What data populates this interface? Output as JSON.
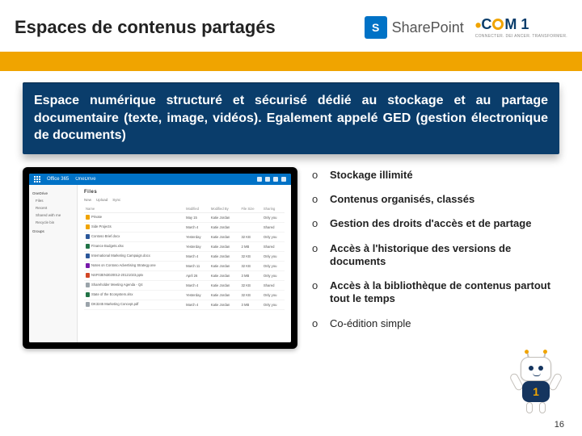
{
  "header": {
    "title": "Espaces de contenus partagés",
    "sharepoint": {
      "icon_letter": "S",
      "label": "SharePoint"
    },
    "com1": {
      "brand_c": "C",
      "brand_m1": "M 1",
      "tagline": "CONNECTER. DEI ANCER. TRANSFORMER."
    }
  },
  "intro": {
    "text": "Espace numérique structuré et sécurisé dédié au stockage et au partage documentaire (texte, image, vidéos). Egalement appelé GED (gestion électronique de documents)"
  },
  "screenshot": {
    "topbar": {
      "app": "Office 365",
      "service": "OneDrive"
    },
    "sidebar": {
      "section1": "OneDrive",
      "items1": [
        "Files",
        "Recent",
        "Shared with me",
        "Recycle bin"
      ],
      "section2": "Groups"
    },
    "crumb": "Files",
    "toolbar": [
      "New",
      "Upload",
      "Sync"
    ],
    "columns": [
      "Name",
      "Modified",
      "Modified By",
      "File Size",
      "Sharing"
    ],
    "rows": [
      {
        "icon": "fi-folder",
        "name": "Private",
        "modified": "May 15",
        "by": "Katie Jordan",
        "size": "",
        "share": "Only you"
      },
      {
        "icon": "fi-folder",
        "name": "Side Projects",
        "modified": "March 4",
        "by": "Katie Jordan",
        "size": "",
        "share": "Shared"
      },
      {
        "icon": "fi-word",
        "name": "Contoso Brief.docx",
        "modified": "Yesterday",
        "by": "Katie Jordan",
        "size": "32 KB",
        "share": "Only you"
      },
      {
        "icon": "fi-excel",
        "name": "Finance Budgets.xlsx",
        "modified": "Yesterday",
        "by": "Katie Jordan",
        "size": "2 MB",
        "share": "Shared"
      },
      {
        "icon": "fi-word",
        "name": "International Marketing Campaign.docx",
        "modified": "March 4",
        "by": "Katie Jordan",
        "size": "32 KB",
        "share": "Only you"
      },
      {
        "icon": "fi-one",
        "name": "Notes on Contoso Advertising Strategy.one",
        "modified": "March 11",
        "by": "Katie Jordan",
        "size": "32 KB",
        "share": "Only you"
      },
      {
        "icon": "fi-ppt",
        "name": "NSF03EN3020012-20121023.pptx",
        "modified": "April 26",
        "by": "Katie Jordan",
        "size": "3 MB",
        "share": "Only you"
      },
      {
        "icon": "fi-gen",
        "name": "Shareholder Meeting Agenda - Q4",
        "modified": "March 4",
        "by": "Katie Jordan",
        "size": "32 KB",
        "share": "Shared"
      },
      {
        "icon": "fi-excel",
        "name": "State of the Ecosystem.xlsx",
        "modified": "Yesterday",
        "by": "Katie Jordan",
        "size": "32 KB",
        "share": "Only you"
      },
      {
        "icon": "fi-gen",
        "name": "DK3245 Marketing Concept.pdf",
        "modified": "March 4",
        "by": "Katie Jordan",
        "size": "3 MB",
        "share": "Only you"
      }
    ]
  },
  "bullets": [
    "Stockage illimité",
    "Contenus organisés, classés",
    "Gestion des droits d'accès et de partage",
    "Accès à l'historique des versions de documents",
    "Accès à la bibliothèque de contenus partout tout le temps",
    "Co-édition simple"
  ],
  "mascot": {
    "body_text": "1"
  },
  "pagenum": "16"
}
